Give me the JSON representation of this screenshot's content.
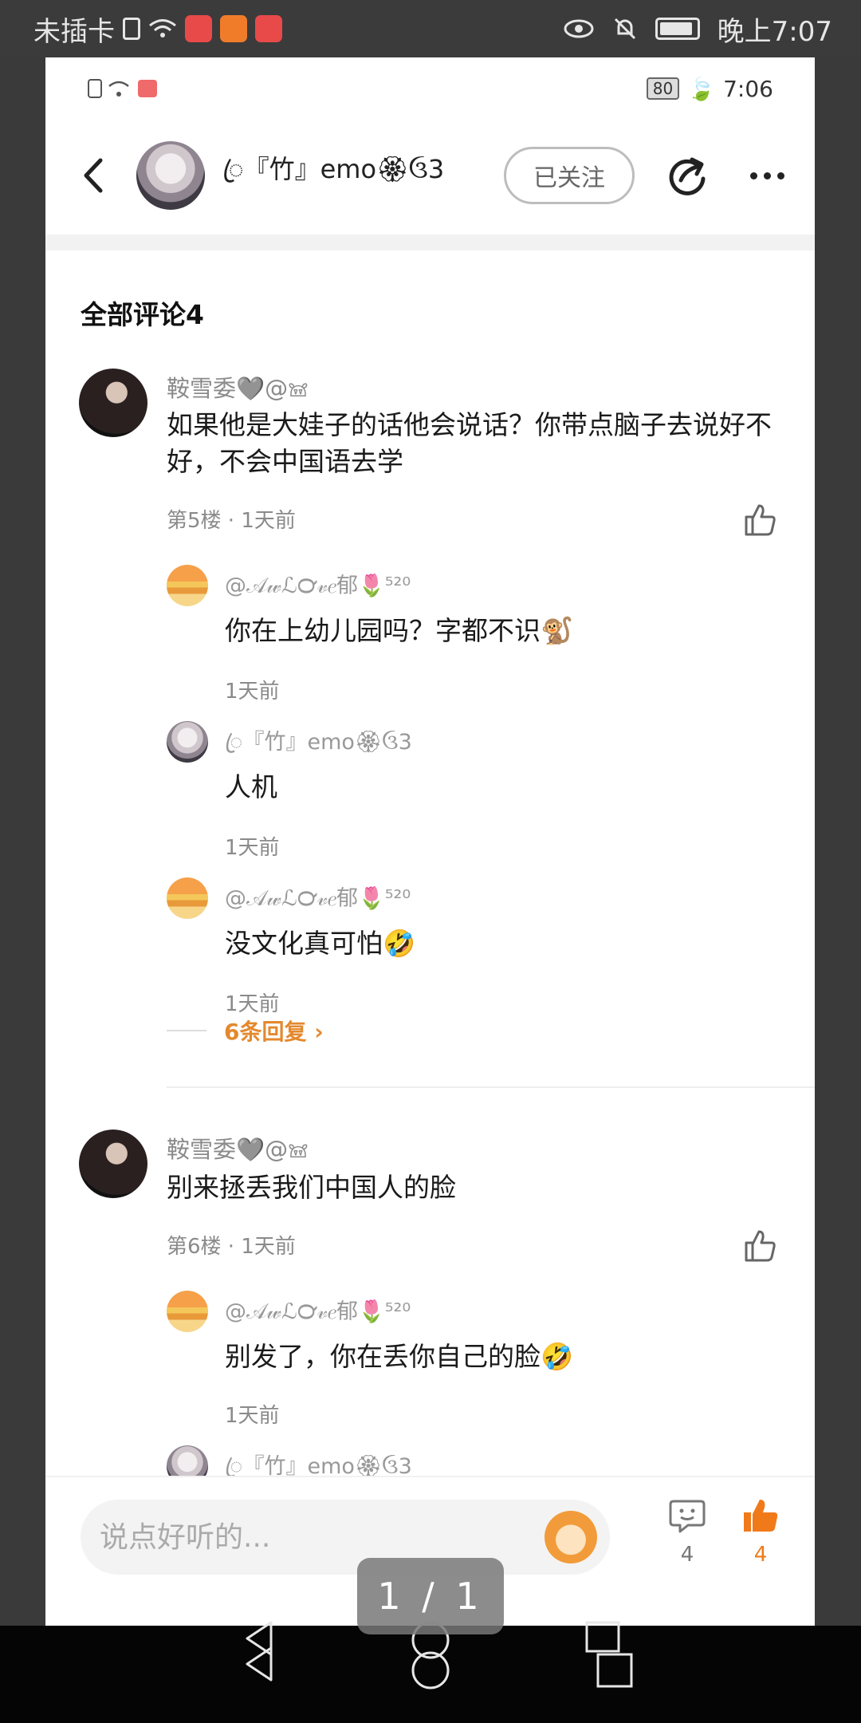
{
  "outer_status": {
    "carrier": "未插卡",
    "time": "晚上7:07"
  },
  "inner_status": {
    "battery": "80",
    "time": "7:06"
  },
  "header": {
    "name": "ꦿ『竹』emo🏵ઉ3",
    "follow_label": "已关注"
  },
  "section_title": "全部评论4",
  "comments": [
    {
      "user": "鞍雪委🩶@𖠌",
      "text": "如果他是大娃子的话他会说话？你带点脑子去说好不好，不会中国语去学",
      "meta": "第5楼 · 1天前",
      "replies": [
        {
          "user": "@𝒜𝓌ℒ℺𝓋𝑒郁🌷⁵²⁰",
          "text": "你在上幼儿园吗？字都不识🐒",
          "time": "1天前"
        },
        {
          "user": "ꦿ『竹』emo🏵ઉ3",
          "text": "人机",
          "time": "1天前"
        },
        {
          "user": "@𝒜𝓌ℒ℺𝓋𝑒郁🌷⁵²⁰",
          "text": "没文化真可怕🤣",
          "time": "1天前"
        }
      ],
      "more_replies": "6条回复 ›"
    },
    {
      "user": "鞍雪委🩶@𖠌",
      "text": "别来拯丢我们中国人的脸",
      "meta": "第6楼 · 1天前",
      "replies": [
        {
          "user": "@𝒜𝓌ℒ℺𝓋𝑒郁🌷⁵²⁰",
          "text": "别发了，你在丢你自己的脸🤣",
          "time": "1天前"
        },
        {
          "user": "ꦿ『竹』emo🏵ઉ3",
          "text": "",
          "time": ""
        }
      ]
    }
  ],
  "bottom_bar": {
    "input_placeholder": "说点好听的...",
    "comment_count": "4",
    "like_count": "4"
  },
  "page_indicator": "1 / 1",
  "colors": {
    "accent": "#f07a1a",
    "more_replies": "#e3892e",
    "muted": "#8a8a8a"
  }
}
